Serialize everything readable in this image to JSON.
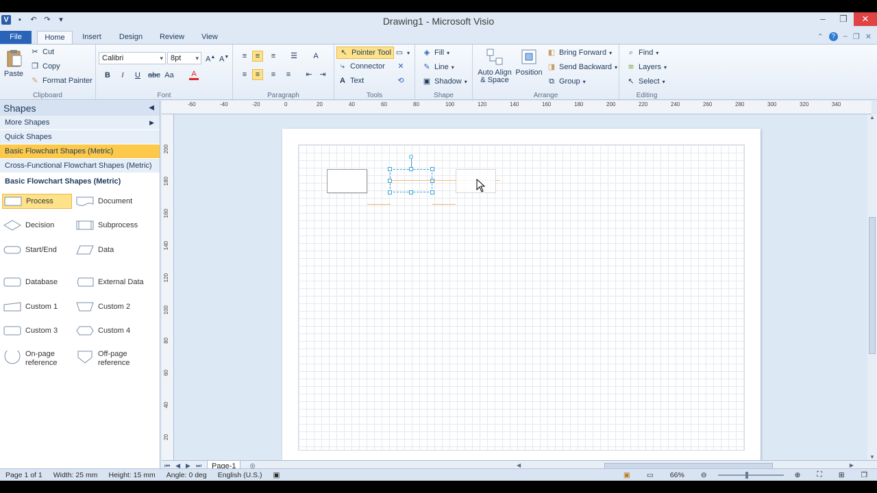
{
  "window": {
    "title": "Drawing1 - Microsoft Visio",
    "app_icon": "V"
  },
  "tabs": [
    "File",
    "Home",
    "Insert",
    "Design",
    "Review",
    "View"
  ],
  "ribbon": {
    "clipboard": {
      "label": "Clipboard",
      "paste": "Paste",
      "cut": "Cut",
      "copy": "Copy",
      "format_painter": "Format Painter"
    },
    "font": {
      "label": "Font",
      "family": "Calibri",
      "size": "8pt"
    },
    "paragraph": {
      "label": "Paragraph"
    },
    "tools": {
      "label": "Tools",
      "pointer": "Pointer Tool",
      "connector": "Connector",
      "text": "Text"
    },
    "shape": {
      "label": "Shape",
      "fill": "Fill",
      "line": "Line",
      "shadow": "Shadow"
    },
    "arrange": {
      "label": "Arrange",
      "auto_align_1": "Auto Align",
      "auto_align_2": "& Space",
      "position": "Position",
      "bring_forward": "Bring Forward",
      "send_backward": "Send Backward",
      "group": "Group"
    },
    "editing": {
      "label": "Editing",
      "find": "Find",
      "layers": "Layers",
      "select": "Select"
    }
  },
  "shapes_panel": {
    "title": "Shapes",
    "more_shapes": "More Shapes",
    "quick_shapes": "Quick Shapes",
    "stencils": [
      "Basic Flowchart Shapes (Metric)",
      "Cross-Functional Flowchart Shapes (Metric)"
    ],
    "active_stencil_title": "Basic Flowchart Shapes (Metric)",
    "masters": [
      {
        "label": "Process"
      },
      {
        "label": "Document"
      },
      {
        "label": "Decision"
      },
      {
        "label": "Subprocess"
      },
      {
        "label": "Start/End"
      },
      {
        "label": "Data"
      },
      {
        "label": "Database"
      },
      {
        "label": "External Data"
      },
      {
        "label": "Custom 1"
      },
      {
        "label": "Custom 2"
      },
      {
        "label": "Custom 3"
      },
      {
        "label": "Custom 4"
      },
      {
        "label": "On-page",
        "label2": "reference"
      },
      {
        "label": "Off-page",
        "label2": "reference"
      }
    ]
  },
  "ruler": {
    "h_ticks": [
      "-60",
      "-40",
      "-20",
      "0",
      "20",
      "40",
      "60",
      "80",
      "100",
      "120",
      "140",
      "160",
      "180",
      "200",
      "220",
      "240",
      "260",
      "280",
      "300",
      "320",
      "340"
    ],
    "v_ticks": [
      "200",
      "180",
      "160",
      "140",
      "120",
      "100",
      "80",
      "60",
      "40",
      "20"
    ]
  },
  "page_tab": "Page-1",
  "status": {
    "page": "Page 1 of 1",
    "width": "Width: 25 mm",
    "height": "Height: 15 mm",
    "angle": "Angle: 0 deg",
    "language": "English (U.S.)",
    "zoom": "66%"
  },
  "colors": {
    "accent": "#2a64b9",
    "selection": "#fde28a",
    "selected_shape": "#3aa0d8",
    "connector_guide": "#f0a040"
  }
}
